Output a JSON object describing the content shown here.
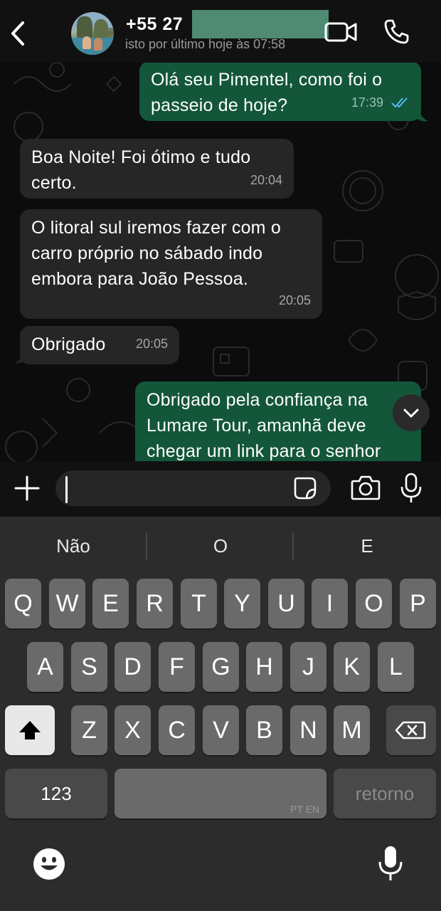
{
  "header": {
    "contact_name": "+55 27",
    "last_seen": "isto por último hoje às 07:58"
  },
  "messages": [
    {
      "direction": "out",
      "text": "Olá seu Pimentel, como foi o\npasseio de hoje?",
      "time": "17:39",
      "read": true
    },
    {
      "direction": "in",
      "text": "Boa Noite! Foi ótimo e  tudo\ncerto.",
      "time": "20:04"
    },
    {
      "direction": "in",
      "text": "O litoral sul iremos fazer com o\ncarro próprio no sábado indo\nembora para João Pessoa.",
      "time": "20:05"
    },
    {
      "direction": "in",
      "text": "Obrigado",
      "time": "20:05"
    },
    {
      "direction": "out",
      "text": "Obrigado pela confiança na\nLumare Tour, amanhã deve\nchegar um link para o senhor"
    }
  ],
  "composer": {
    "value": ""
  },
  "keyboard": {
    "suggestions": [
      "Não",
      "O",
      "E"
    ],
    "row1": [
      "Q",
      "W",
      "E",
      "R",
      "T",
      "Y",
      "U",
      "I",
      "O",
      "P"
    ],
    "row2": [
      "A",
      "S",
      "D",
      "F",
      "G",
      "H",
      "J",
      "K",
      "L"
    ],
    "row3": [
      "Z",
      "X",
      "C",
      "V",
      "B",
      "N",
      "M"
    ],
    "numbers_key": "123",
    "space_languages": "PT EN",
    "return_key": "retorno"
  },
  "colors": {
    "outgoing_bubble": "#13563a",
    "incoming_bubble": "#262626",
    "read_ticks": "#53bdeb"
  },
  "icons": [
    "back-chevron-icon",
    "video-call-icon",
    "phone-call-icon",
    "read-ticks-icon",
    "chevron-down-icon",
    "plus-icon",
    "sticker-icon",
    "camera-icon",
    "microphone-icon",
    "shift-arrow-icon",
    "backspace-icon",
    "emoji-icon",
    "dictation-icon"
  ]
}
